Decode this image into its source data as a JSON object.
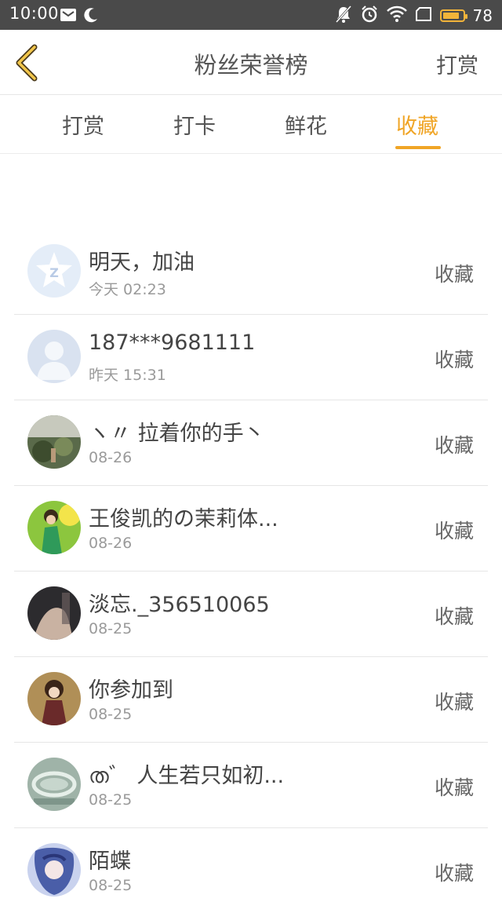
{
  "status_bar": {
    "time": "10:00",
    "battery_level": "78",
    "icons": [
      "message-icon",
      "moon-icon",
      "mute-icon",
      "alarm-icon",
      "wifi-icon",
      "sim-icon",
      "battery-icon"
    ],
    "battery_color": "#f2b43a"
  },
  "header": {
    "back_icon": "chevron-left-icon",
    "title": "粉丝荣誉榜",
    "action_label": "打赏"
  },
  "tabs": [
    {
      "label": "打赏"
    },
    {
      "label": "打卡"
    },
    {
      "label": "鲜花"
    },
    {
      "label": "收藏"
    }
  ],
  "active_tab": "收藏",
  "accent_color": "#f0a526",
  "entries": [
    {
      "name": "明天，加油",
      "time": "今天 02:23",
      "action": "收藏",
      "avatar": "qq-default-avatar"
    },
    {
      "name": "187***9681111",
      "time": "昨天 15:31",
      "action": "收藏",
      "avatar": "default-person-avatar"
    },
    {
      "name": "ヽ〃 拉着你的手丶",
      "time": "08-26",
      "action": "收藏",
      "avatar": "photo-avatar"
    },
    {
      "name": "王俊凯的の茉莉体...",
      "time": "08-26",
      "action": "收藏",
      "avatar": "photo-avatar"
    },
    {
      "name": "淡忘._356510065",
      "time": "08-25",
      "action": "收藏",
      "avatar": "photo-avatar"
    },
    {
      "name": "你参加到",
      "time": "08-25",
      "action": "收藏",
      "avatar": "photo-avatar"
    },
    {
      "name": "ത゛ 人生若只如初...",
      "time": "08-25",
      "action": "收藏",
      "avatar": "photo-avatar"
    },
    {
      "name": "陌蝶",
      "time": "08-25",
      "action": "收藏",
      "avatar": "photo-avatar"
    }
  ]
}
